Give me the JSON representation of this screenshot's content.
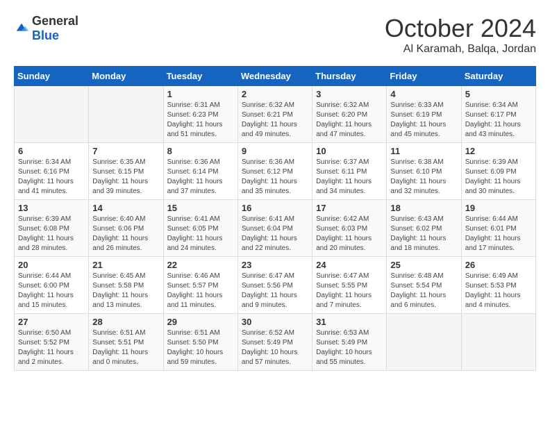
{
  "header": {
    "logo_general": "General",
    "logo_blue": "Blue",
    "month_title": "October 2024",
    "location": "Al Karamah, Balqa, Jordan"
  },
  "days_of_week": [
    "Sunday",
    "Monday",
    "Tuesday",
    "Wednesday",
    "Thursday",
    "Friday",
    "Saturday"
  ],
  "weeks": [
    [
      {
        "day": "",
        "content": ""
      },
      {
        "day": "",
        "content": ""
      },
      {
        "day": "1",
        "content": "Sunrise: 6:31 AM\nSunset: 6:23 PM\nDaylight: 11 hours and 51 minutes."
      },
      {
        "day": "2",
        "content": "Sunrise: 6:32 AM\nSunset: 6:21 PM\nDaylight: 11 hours and 49 minutes."
      },
      {
        "day": "3",
        "content": "Sunrise: 6:32 AM\nSunset: 6:20 PM\nDaylight: 11 hours and 47 minutes."
      },
      {
        "day": "4",
        "content": "Sunrise: 6:33 AM\nSunset: 6:19 PM\nDaylight: 11 hours and 45 minutes."
      },
      {
        "day": "5",
        "content": "Sunrise: 6:34 AM\nSunset: 6:17 PM\nDaylight: 11 hours and 43 minutes."
      }
    ],
    [
      {
        "day": "6",
        "content": "Sunrise: 6:34 AM\nSunset: 6:16 PM\nDaylight: 11 hours and 41 minutes."
      },
      {
        "day": "7",
        "content": "Sunrise: 6:35 AM\nSunset: 6:15 PM\nDaylight: 11 hours and 39 minutes."
      },
      {
        "day": "8",
        "content": "Sunrise: 6:36 AM\nSunset: 6:14 PM\nDaylight: 11 hours and 37 minutes."
      },
      {
        "day": "9",
        "content": "Sunrise: 6:36 AM\nSunset: 6:12 PM\nDaylight: 11 hours and 35 minutes."
      },
      {
        "day": "10",
        "content": "Sunrise: 6:37 AM\nSunset: 6:11 PM\nDaylight: 11 hours and 34 minutes."
      },
      {
        "day": "11",
        "content": "Sunrise: 6:38 AM\nSunset: 6:10 PM\nDaylight: 11 hours and 32 minutes."
      },
      {
        "day": "12",
        "content": "Sunrise: 6:39 AM\nSunset: 6:09 PM\nDaylight: 11 hours and 30 minutes."
      }
    ],
    [
      {
        "day": "13",
        "content": "Sunrise: 6:39 AM\nSunset: 6:08 PM\nDaylight: 11 hours and 28 minutes."
      },
      {
        "day": "14",
        "content": "Sunrise: 6:40 AM\nSunset: 6:06 PM\nDaylight: 11 hours and 26 minutes."
      },
      {
        "day": "15",
        "content": "Sunrise: 6:41 AM\nSunset: 6:05 PM\nDaylight: 11 hours and 24 minutes."
      },
      {
        "day": "16",
        "content": "Sunrise: 6:41 AM\nSunset: 6:04 PM\nDaylight: 11 hours and 22 minutes."
      },
      {
        "day": "17",
        "content": "Sunrise: 6:42 AM\nSunset: 6:03 PM\nDaylight: 11 hours and 20 minutes."
      },
      {
        "day": "18",
        "content": "Sunrise: 6:43 AM\nSunset: 6:02 PM\nDaylight: 11 hours and 18 minutes."
      },
      {
        "day": "19",
        "content": "Sunrise: 6:44 AM\nSunset: 6:01 PM\nDaylight: 11 hours and 17 minutes."
      }
    ],
    [
      {
        "day": "20",
        "content": "Sunrise: 6:44 AM\nSunset: 6:00 PM\nDaylight: 11 hours and 15 minutes."
      },
      {
        "day": "21",
        "content": "Sunrise: 6:45 AM\nSunset: 5:58 PM\nDaylight: 11 hours and 13 minutes."
      },
      {
        "day": "22",
        "content": "Sunrise: 6:46 AM\nSunset: 5:57 PM\nDaylight: 11 hours and 11 minutes."
      },
      {
        "day": "23",
        "content": "Sunrise: 6:47 AM\nSunset: 5:56 PM\nDaylight: 11 hours and 9 minutes."
      },
      {
        "day": "24",
        "content": "Sunrise: 6:47 AM\nSunset: 5:55 PM\nDaylight: 11 hours and 7 minutes."
      },
      {
        "day": "25",
        "content": "Sunrise: 6:48 AM\nSunset: 5:54 PM\nDaylight: 11 hours and 6 minutes."
      },
      {
        "day": "26",
        "content": "Sunrise: 6:49 AM\nSunset: 5:53 PM\nDaylight: 11 hours and 4 minutes."
      }
    ],
    [
      {
        "day": "27",
        "content": "Sunrise: 6:50 AM\nSunset: 5:52 PM\nDaylight: 11 hours and 2 minutes."
      },
      {
        "day": "28",
        "content": "Sunrise: 6:51 AM\nSunset: 5:51 PM\nDaylight: 11 hours and 0 minutes."
      },
      {
        "day": "29",
        "content": "Sunrise: 6:51 AM\nSunset: 5:50 PM\nDaylight: 10 hours and 59 minutes."
      },
      {
        "day": "30",
        "content": "Sunrise: 6:52 AM\nSunset: 5:49 PM\nDaylight: 10 hours and 57 minutes."
      },
      {
        "day": "31",
        "content": "Sunrise: 6:53 AM\nSunset: 5:49 PM\nDaylight: 10 hours and 55 minutes."
      },
      {
        "day": "",
        "content": ""
      },
      {
        "day": "",
        "content": ""
      }
    ]
  ]
}
